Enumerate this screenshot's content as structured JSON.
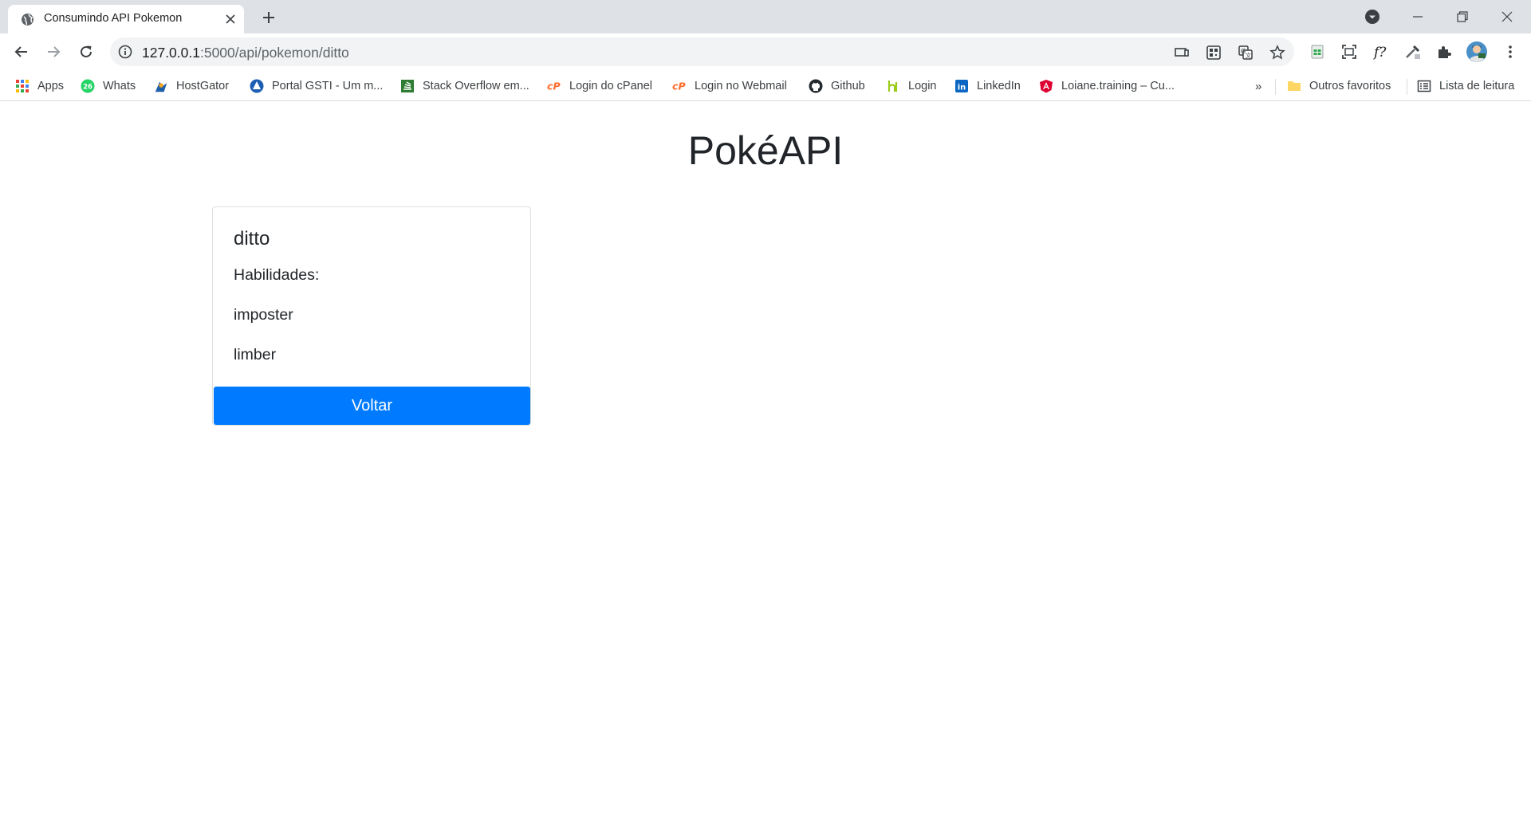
{
  "browser": {
    "tab_title": "Consumindo API Pokemon",
    "url_host": "127.0.0.1",
    "url_path": ":5000/api/pokemon/ditto",
    "bookmarks": [
      {
        "label": "Apps",
        "icon": "apps-grid-icon"
      },
      {
        "label": "Whats",
        "icon": "whatsapp-icon",
        "badge": "26"
      },
      {
        "label": "HostGator",
        "icon": "hostgator-icon"
      },
      {
        "label": "Portal GSTI - Um m...",
        "icon": "portal-gsti-icon"
      },
      {
        "label": "Stack Overflow em...",
        "icon": "stackoverflow-icon"
      },
      {
        "label": "Login do cPanel",
        "icon": "cpanel-icon"
      },
      {
        "label": "Login no Webmail",
        "icon": "cpanel-icon"
      },
      {
        "label": "Github",
        "icon": "github-icon"
      },
      {
        "label": "Login",
        "icon": "login-icon"
      },
      {
        "label": "LinkedIn",
        "icon": "linkedin-icon"
      },
      {
        "label": "Loiane.training – Cu...",
        "icon": "angular-icon"
      }
    ],
    "overflow_label": "»",
    "other_bookmarks": "Outros favoritos",
    "reading_list": "Lista de leitura",
    "colors": {
      "tabstrip": "#dee1e6",
      "omnibox": "#f1f3f4"
    }
  },
  "page": {
    "title": "PokéAPI",
    "pokemon": {
      "name": "ditto",
      "abilities_label": "Habilidades:",
      "abilities": [
        "imposter",
        "limber"
      ]
    },
    "back_button": "Voltar",
    "colors": {
      "primary": "#007bff",
      "text": "#212529"
    }
  }
}
